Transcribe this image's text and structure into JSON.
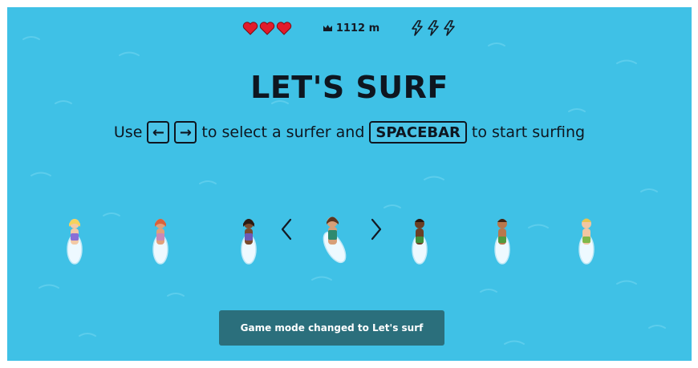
{
  "hud": {
    "lives": 3,
    "distance_text": "1112 m",
    "boosts": 3
  },
  "title": "LET'S SURF",
  "instructions": {
    "use": "Use",
    "left_key": "←",
    "right_key": "→",
    "middle": "to select a surfer and",
    "spacebar": "SPACEBAR",
    "end": "to start surfing"
  },
  "surfers": {
    "count": 7,
    "selected_index": 3
  },
  "toast": {
    "message": "Game mode changed to Let's surf"
  },
  "colors": {
    "water": "#3fc1e6",
    "heart": "#e21b2b",
    "text": "#0e1620",
    "toast_bg": "#2b6f7c"
  }
}
